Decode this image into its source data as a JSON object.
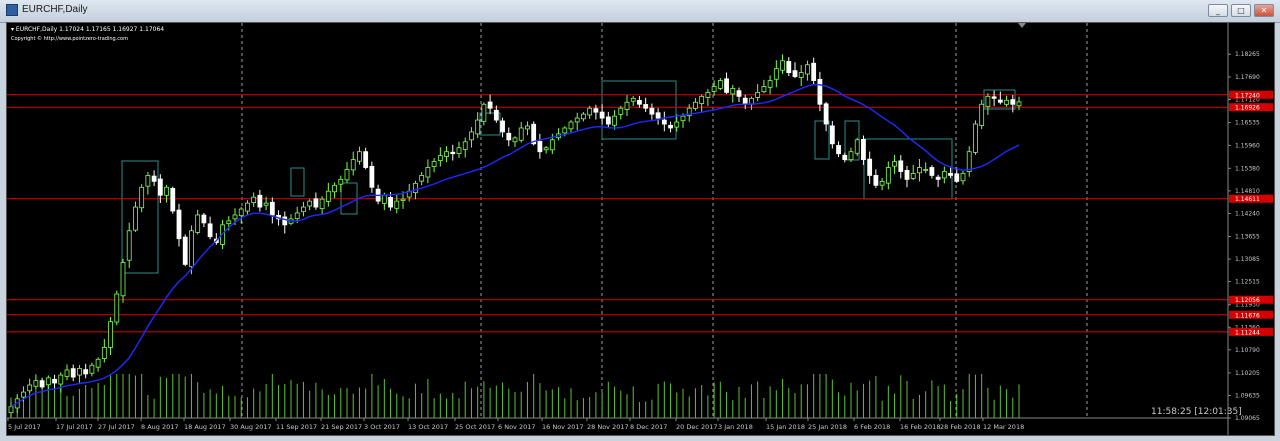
{
  "window": {
    "title": "EURCHF,Daily",
    "buttons": {
      "minimize": "_",
      "restore": "□",
      "close": "✕"
    }
  },
  "chart_header": {
    "symbol_line": "▾ EURCHF,Daily  1.17024 1.17165 1.16927 1.17064",
    "copyright": "Copyright © http://www.pointzero-trading.com"
  },
  "clock": "11:58:25 [12:01:35]",
  "colors": {
    "background": "#000000",
    "bull_candle": "#7CFF4E",
    "bear_candle": "#FFFFFF",
    "ma_line": "#1E2BFF",
    "levels": "#E00000",
    "boxes": "#2E8B8B",
    "volume": "#5CC42E",
    "grid": "#C8C8C8"
  },
  "chart_data": {
    "type": "candlestick",
    "symbol": "EURCHF",
    "timeframe": "Daily",
    "ohlc_last": {
      "open": 1.17024,
      "high": 1.17165,
      "low": 1.16927,
      "close": 1.17064
    },
    "y_ticks": [
      "1.18265",
      "1.17690",
      "1.17120",
      "1.16535",
      "1.15960",
      "1.15380",
      "1.14810",
      "1.14240",
      "1.13655",
      "1.13085",
      "1.12515",
      "1.11930",
      "1.11360",
      "1.10790",
      "1.10205",
      "1.09635",
      "1.09065"
    ],
    "y_range": [
      1.09065,
      1.186
    ],
    "x_ticks": [
      "5 Jul 2017",
      "17 Jul 2017",
      "27 Jul 2017",
      "8 Aug 2017",
      "18 Aug 2017",
      "30 Aug 2017",
      "11 Sep 2017",
      "21 Sep 2017",
      "3 Oct 2017",
      "13 Oct 2017",
      "25 Oct 2017",
      "6 Nov 2017",
      "16 Nov 2017",
      "28 Nov 2017",
      "8 Dec 2017",
      "20 Dec 2017",
      "3 Jan 2018",
      "15 Jan 2018",
      "25 Jan 2018",
      "6 Feb 2018",
      "16 Feb 2018",
      "28 Feb 2018",
      "12 Mar 2018"
    ],
    "level_lines": [
      {
        "price": 1.1724,
        "label": "1.17240"
      },
      {
        "price": 1.16926,
        "label": "1.16926"
      },
      {
        "price": 1.14611,
        "label": "1.14611"
      },
      {
        "price": 1.12056,
        "label": "1.12056"
      },
      {
        "price": 1.11676,
        "label": "1.11676"
      },
      {
        "price": 1.11244,
        "label": "1.11244"
      }
    ],
    "grid": "vertical dashed",
    "closes": [
      1.0935,
      1.0955,
      1.0972,
      1.099,
      1.1001,
      1.0985,
      1.1008,
      1.0995,
      1.1015,
      1.1028,
      1.101,
      1.1032,
      1.1018,
      1.104,
      1.1055,
      1.1085,
      1.115,
      1.122,
      1.13,
      1.138,
      1.144,
      1.149,
      1.152,
      1.1505,
      1.147,
      1.149,
      1.143,
      1.136,
      1.1295,
      1.138,
      1.142,
      1.14,
      1.1365,
      1.135,
      1.1395,
      1.1405,
      1.142,
      1.1435,
      1.145,
      1.1465,
      1.144,
      1.145,
      1.142,
      1.141,
      1.1395,
      1.141,
      1.1425,
      1.144,
      1.1455,
      1.144,
      1.146,
      1.148,
      1.1495,
      1.151,
      1.1535,
      1.156,
      1.158,
      1.154,
      1.149,
      1.1455,
      1.147,
      1.144,
      1.1455,
      1.146,
      1.148,
      1.15,
      1.152,
      1.154,
      1.1555,
      1.157,
      1.158,
      1.1575,
      1.159,
      1.1605,
      1.163,
      1.166,
      1.17,
      1.169,
      1.166,
      1.163,
      1.161,
      1.1615,
      1.164,
      1.1645,
      1.16,
      1.158,
      1.159,
      1.161,
      1.1625,
      1.164,
      1.1655,
      1.1665,
      1.1675,
      1.169,
      1.168,
      1.1665,
      1.165,
      1.167,
      1.169,
      1.1705,
      1.1715,
      1.17,
      1.169,
      1.1675,
      1.1665,
      1.165,
      1.164,
      1.1655,
      1.167,
      1.169,
      1.1705,
      1.172,
      1.173,
      1.1745,
      1.176,
      1.173,
      1.174,
      1.172,
      1.17,
      1.1715,
      1.173,
      1.1745,
      1.176,
      1.179,
      1.181,
      1.178,
      1.177,
      1.178,
      1.18,
      1.176,
      1.17,
      1.165,
      1.16,
      1.1575,
      1.156,
      1.158,
      1.161,
      1.156,
      1.152,
      1.1495,
      1.1505,
      1.154,
      1.1555,
      1.153,
      1.151,
      1.1525,
      1.154,
      1.1535,
      1.152,
      1.151,
      1.153,
      1.152,
      1.1505,
      1.1525,
      1.158,
      1.165,
      1.17,
      1.172,
      1.1715,
      1.1705,
      1.171,
      1.17,
      1.1706
    ]
  }
}
